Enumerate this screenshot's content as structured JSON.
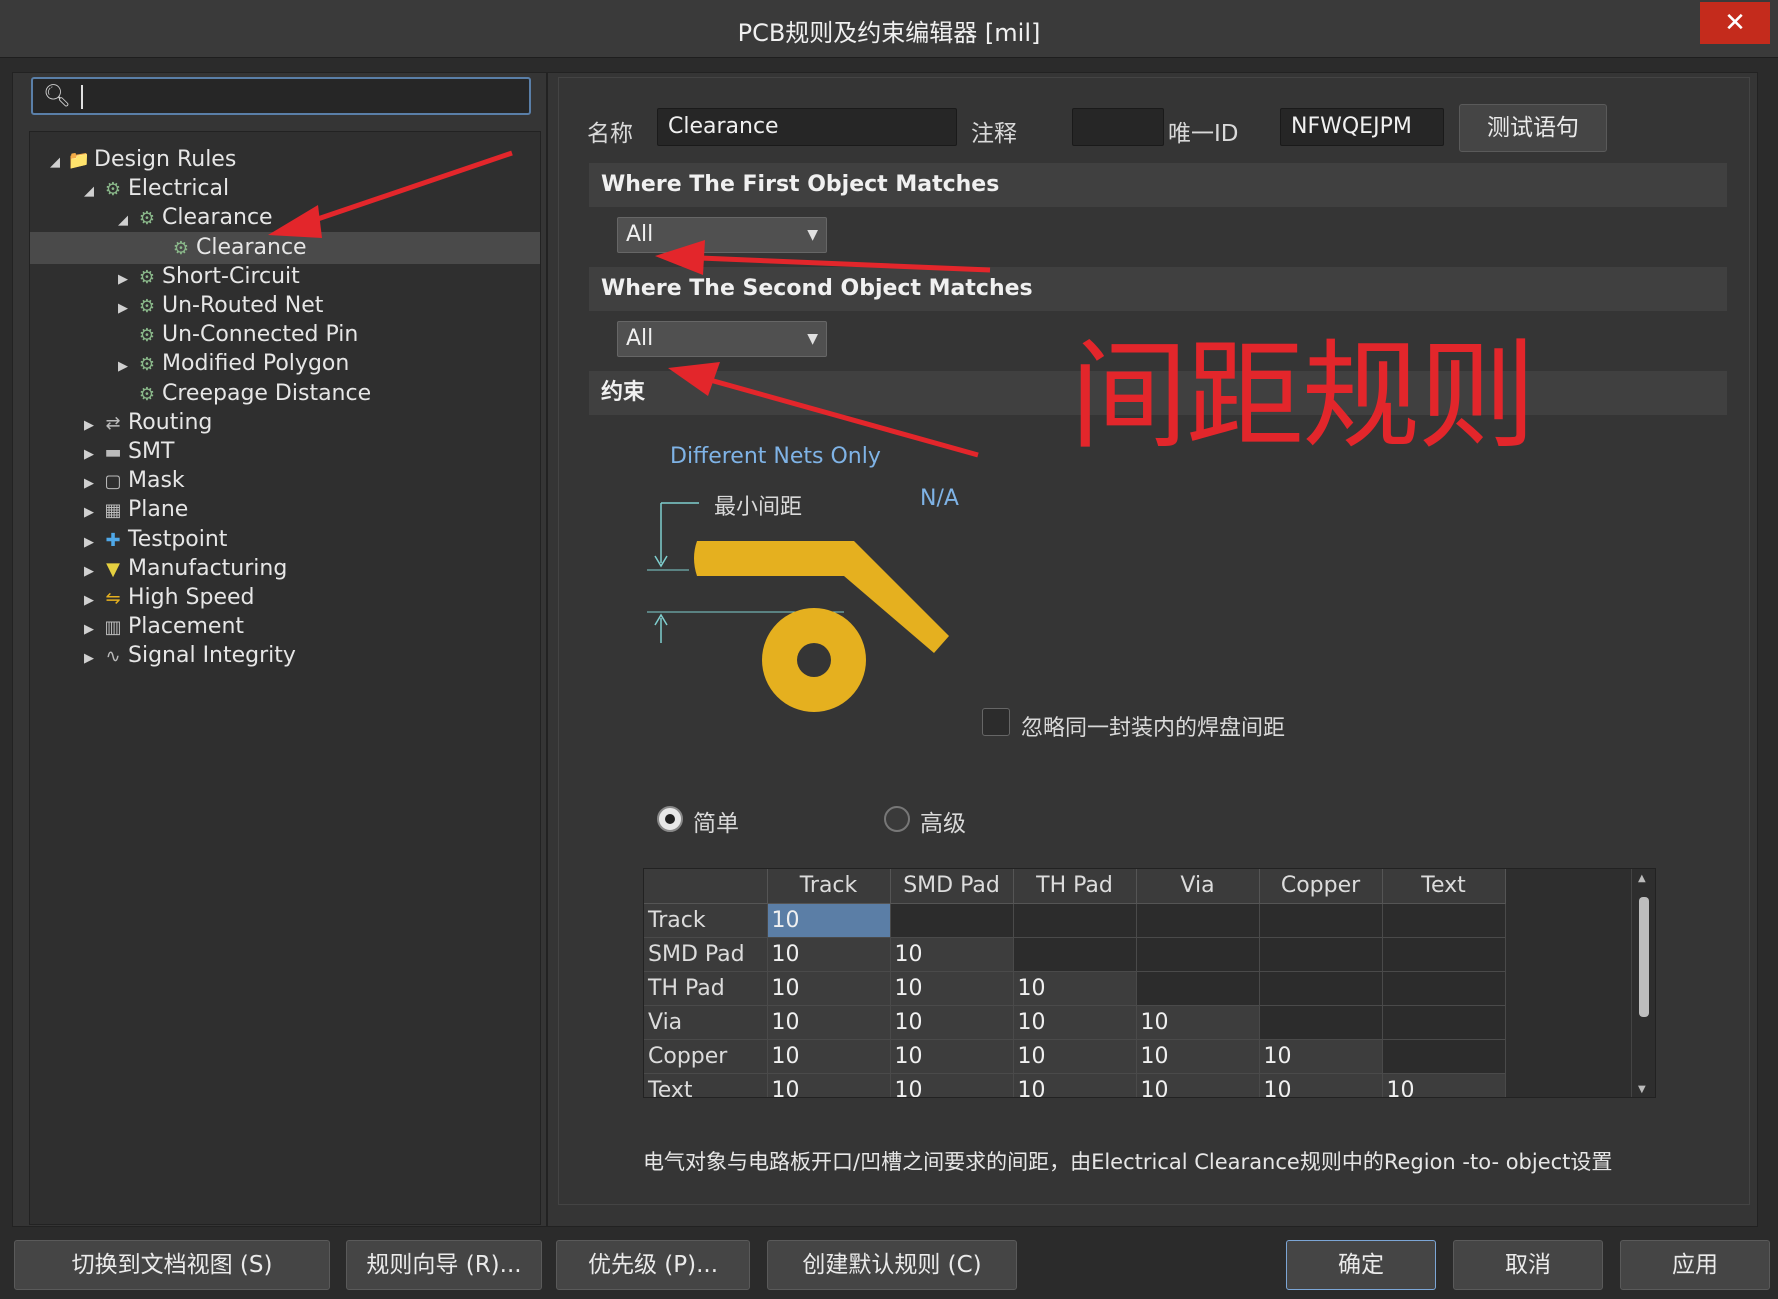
{
  "window": {
    "title": "PCB规则及约束编辑器 [mil]",
    "close_label": "✕"
  },
  "search": {
    "value": ""
  },
  "tree": {
    "items": [
      {
        "label": "Design Rules",
        "toggle": "◢",
        "icon": "📁"
      },
      {
        "label": "Electrical",
        "toggle": "◢",
        "icon": "⚙"
      },
      {
        "label": "Clearance",
        "toggle": "◢",
        "icon": "⚙"
      },
      {
        "label": "Clearance",
        "toggle": "",
        "icon": "⚙"
      },
      {
        "label": "Short-Circuit",
        "toggle": "▶",
        "icon": "⚙"
      },
      {
        "label": "Un-Routed Net",
        "toggle": "▶",
        "icon": "⚙"
      },
      {
        "label": "Un-Connected Pin",
        "toggle": "",
        "icon": "⚙"
      },
      {
        "label": "Modified Polygon",
        "toggle": "▶",
        "icon": "⚙"
      },
      {
        "label": "Creepage Distance",
        "toggle": "",
        "icon": "⚙"
      },
      {
        "label": "Routing",
        "toggle": "▶",
        "icon": "⇄"
      },
      {
        "label": "SMT",
        "toggle": "▶",
        "icon": "▬"
      },
      {
        "label": "Mask",
        "toggle": "▶",
        "icon": "▢"
      },
      {
        "label": "Plane",
        "toggle": "▶",
        "icon": "▦"
      },
      {
        "label": "Testpoint",
        "toggle": "▶",
        "icon": "✚"
      },
      {
        "label": "Manufacturing",
        "toggle": "▶",
        "icon": "▼"
      },
      {
        "label": "High Speed",
        "toggle": "▶",
        "icon": "⇋"
      },
      {
        "label": "Placement",
        "toggle": "▶",
        "icon": "▥"
      },
      {
        "label": "Signal Integrity",
        "toggle": "▶",
        "icon": "∿"
      }
    ]
  },
  "rule": {
    "name_label": "名称",
    "name_value": "Clearance",
    "comment_label": "注释",
    "comment_value": "",
    "uid_label": "唯一ID",
    "uid_value": "NFWQEJPM",
    "test_button": "测试语句"
  },
  "first_match": {
    "header": "Where The First Object Matches",
    "value": "All"
  },
  "second_match": {
    "header": "Where The Second Object Matches",
    "value": "All"
  },
  "constraints": {
    "header": "约束",
    "net_scope": "Different Nets Only",
    "min_clearance_label": "最小间距",
    "min_clearance_value": "N/A",
    "ignore_pads_label": "忽略同一封装内的焊盘间距",
    "simple_label": "简单",
    "advanced_label": "高级"
  },
  "annotation": {
    "text": "间距规则"
  },
  "grid": {
    "columns": [
      "Track",
      "SMD Pad",
      "TH Pad",
      "Via",
      "Copper",
      "Text"
    ],
    "rows": [
      {
        "name": "Track",
        "values": [
          "10",
          "",
          "",
          "",
          "",
          ""
        ]
      },
      {
        "name": "SMD Pad",
        "values": [
          "10",
          "10",
          "",
          "",
          "",
          ""
        ]
      },
      {
        "name": "TH Pad",
        "values": [
          "10",
          "10",
          "10",
          "",
          "",
          ""
        ]
      },
      {
        "name": "Via",
        "values": [
          "10",
          "10",
          "10",
          "10",
          "",
          ""
        ]
      },
      {
        "name": "Copper",
        "values": [
          "10",
          "10",
          "10",
          "10",
          "10",
          ""
        ]
      },
      {
        "name": "Text",
        "values": [
          "10",
          "10",
          "10",
          "10",
          "10",
          "10"
        ]
      }
    ]
  },
  "footer_note": "电气对象与电路板开口/凹槽之间要求的间距，由Electrical Clearance规则中的Region -to- object设置",
  "buttons": {
    "switch_doc": "切换到文档视图 (S)",
    "wizard": "规则向导 (R)...",
    "priority": "优先级 (P)...",
    "create_default": "创建默认规则 (C)",
    "ok": "确定",
    "cancel": "取消",
    "apply": "应用"
  },
  "colors": {
    "annotation_red": "#e3262b",
    "track_yellow": "#e5b01f",
    "selection_blue": "#5b7ea6"
  }
}
